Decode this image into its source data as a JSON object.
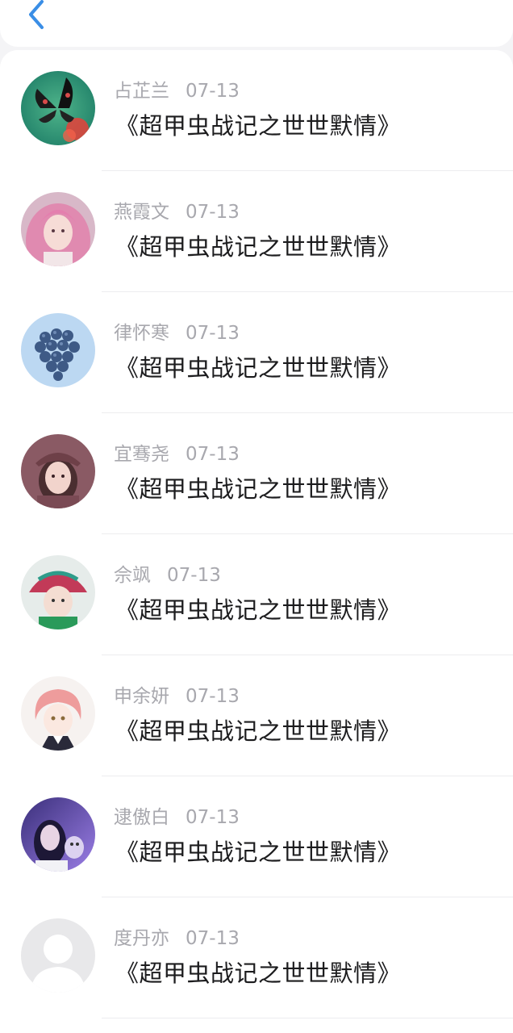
{
  "header": {
    "back_icon": "chevron-left-icon",
    "accent_color": "#3a8ee6"
  },
  "comments": [
    {
      "name": "占芷兰",
      "date": "07-13",
      "text": "《超甲虫战记之世世默情》",
      "avatar": "butterfly"
    },
    {
      "name": "燕霞文",
      "date": "07-13",
      "text": "《超甲虫战记之世世默情》",
      "avatar": "pink-hair-girl"
    },
    {
      "name": "律怀寒",
      "date": "07-13",
      "text": "《超甲虫战记之世世默情》",
      "avatar": "blue-balls"
    },
    {
      "name": "宜骞尧",
      "date": "07-13",
      "text": "《超甲虫战记之世世默情》",
      "avatar": "girl-cap"
    },
    {
      "name": "佘飒",
      "date": "07-13",
      "text": "《超甲虫战记之世世默情》",
      "avatar": "child-bucket-hat"
    },
    {
      "name": "申余妍",
      "date": "07-13",
      "text": "《超甲虫战记之世世默情》",
      "avatar": "anime-girl"
    },
    {
      "name": "逮傲白",
      "date": "07-13",
      "text": "《超甲虫战记之世世默情》",
      "avatar": "girl-purple"
    },
    {
      "name": "度丹亦",
      "date": "07-13",
      "text": "《超甲虫战记之世世默情》",
      "avatar": "default-user"
    }
  ]
}
